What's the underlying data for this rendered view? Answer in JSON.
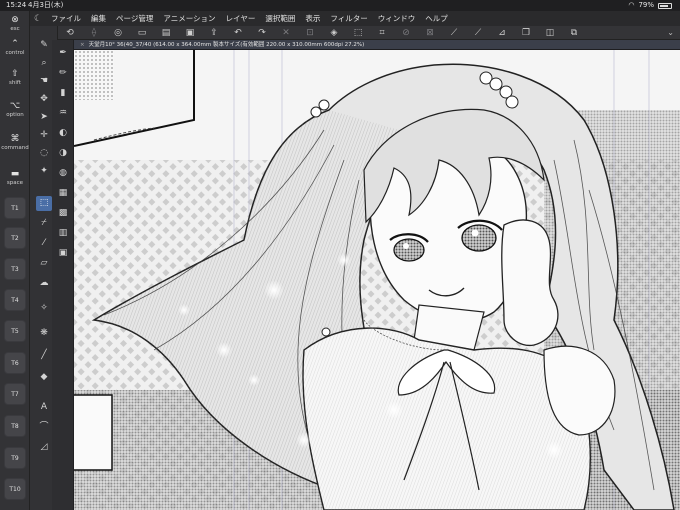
{
  "status_bar": {
    "time": "15:24",
    "date": "4月3日(木)",
    "battery": "79%",
    "battery_level": 0.79
  },
  "menu_bar": {
    "items": [
      "ファイル",
      "編集",
      "ページ管理",
      "アニメーション",
      "レイヤー",
      "選択範囲",
      "表示",
      "フィルター",
      "ウィンドウ",
      "ヘルプ"
    ]
  },
  "modifier_panel": {
    "esc": "esc",
    "control": "control",
    "shift": "shift",
    "option": "option",
    "command": "command",
    "space": "space",
    "tkeys": [
      "T1",
      "T2",
      "T3",
      "T4",
      "T5",
      "T6",
      "T7",
      "T8",
      "T9",
      "T10"
    ]
  },
  "document_tab": {
    "title": "天堂月10° 36(40_37/40 (614.00 x 364.00mm 製本サイズ(有効範囲 220.00 x 310.00mm 600dpi 27.2%)"
  },
  "colors": {
    "accent": "#4a6ea6",
    "foreground_color": "#000000",
    "background_color": "#ffffff"
  }
}
